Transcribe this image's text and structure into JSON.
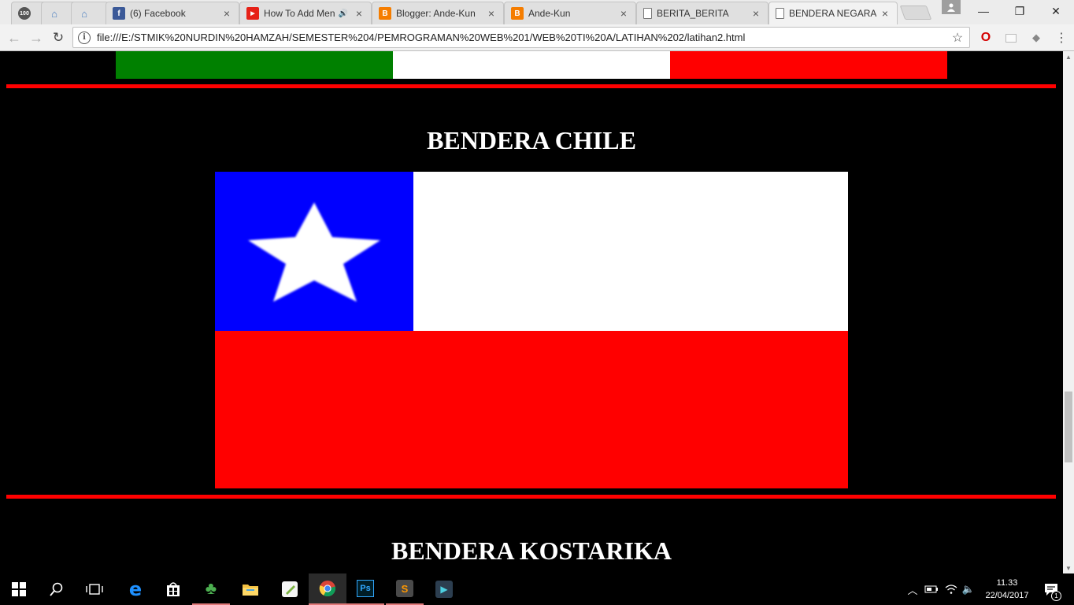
{
  "browser": {
    "tabs": [
      {
        "title": "",
        "icon": "100-icon",
        "active": false
      },
      {
        "title": "",
        "icon": "home-icon",
        "active": false
      },
      {
        "title": "",
        "icon": "home-icon",
        "active": false
      },
      {
        "title": "(6) Facebook",
        "icon": "facebook-icon",
        "active": false
      },
      {
        "title": "How To Add Men",
        "icon": "youtube-icon",
        "active": false,
        "audio": true
      },
      {
        "title": "Blogger: Ande-Kun",
        "icon": "blogger-icon",
        "active": false
      },
      {
        "title": "Ande-Kun",
        "icon": "blogger-icon",
        "active": false
      },
      {
        "title": "BERITA_BERITA",
        "icon": "document-icon",
        "active": false
      },
      {
        "title": "BENDERA NEGARA",
        "icon": "document-icon",
        "active": true
      }
    ],
    "url": "file:///E:/STMIK%20NURDIN%20HAMZAH/SEMESTER%204/PEMROGRAMAN%20WEB%201/WEB%20TI%20A/LATIHAN%202/latihan2.html",
    "tab_icon_labels": {
      "hundred": "100"
    }
  },
  "page": {
    "italy_flag_colors": [
      "#008000",
      "#ffffff",
      "#ff0000"
    ],
    "chile_heading": "BENDERA CHILE",
    "kostarika_heading": "BENDERA KOSTARIKA",
    "chile_flag_colors": {
      "blue": "#0000ff",
      "white": "#ffffff",
      "red": "#ff0000",
      "star": "#ffffff"
    },
    "separator_color": "#ff0000"
  },
  "taskbar": {
    "apps": [
      "start",
      "search",
      "task-view",
      "edge",
      "store",
      "clover",
      "file-explorer",
      "notepad",
      "chrome",
      "photoshop",
      "sublime",
      "filmora"
    ],
    "active_app": "chrome",
    "clock_time": "11.33",
    "clock_date": "22/04/2017",
    "notification_count": "1"
  }
}
